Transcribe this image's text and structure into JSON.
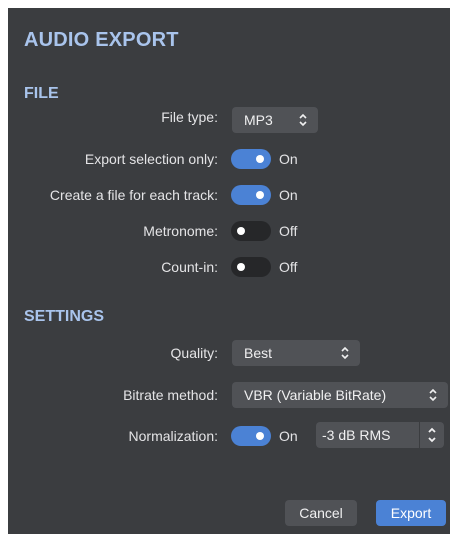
{
  "dialog": {
    "title": "AUDIO EXPORT"
  },
  "file_section": {
    "heading": "FILE",
    "file_type": {
      "label": "File type:",
      "value": "MP3"
    },
    "export_selection_only": {
      "label": "Export selection only:",
      "state": "On"
    },
    "file_per_track": {
      "label": "Create a file for each track:",
      "state": "On"
    },
    "metronome": {
      "label": "Metronome:",
      "state": "Off"
    },
    "count_in": {
      "label": "Count-in:",
      "state": "Off"
    }
  },
  "settings_section": {
    "heading": "SETTINGS",
    "quality": {
      "label": "Quality:",
      "value": "Best"
    },
    "bitrate_method": {
      "label": "Bitrate method:",
      "value": "VBR (Variable BitRate)"
    },
    "normalization": {
      "label": "Normalization:",
      "state": "On",
      "level": "-3 dB RMS"
    }
  },
  "buttons": {
    "cancel": "Cancel",
    "export": "Export"
  },
  "colors": {
    "accent": "#4b82d5",
    "heading": "#a9c4ec",
    "background": "#3b3d40"
  }
}
